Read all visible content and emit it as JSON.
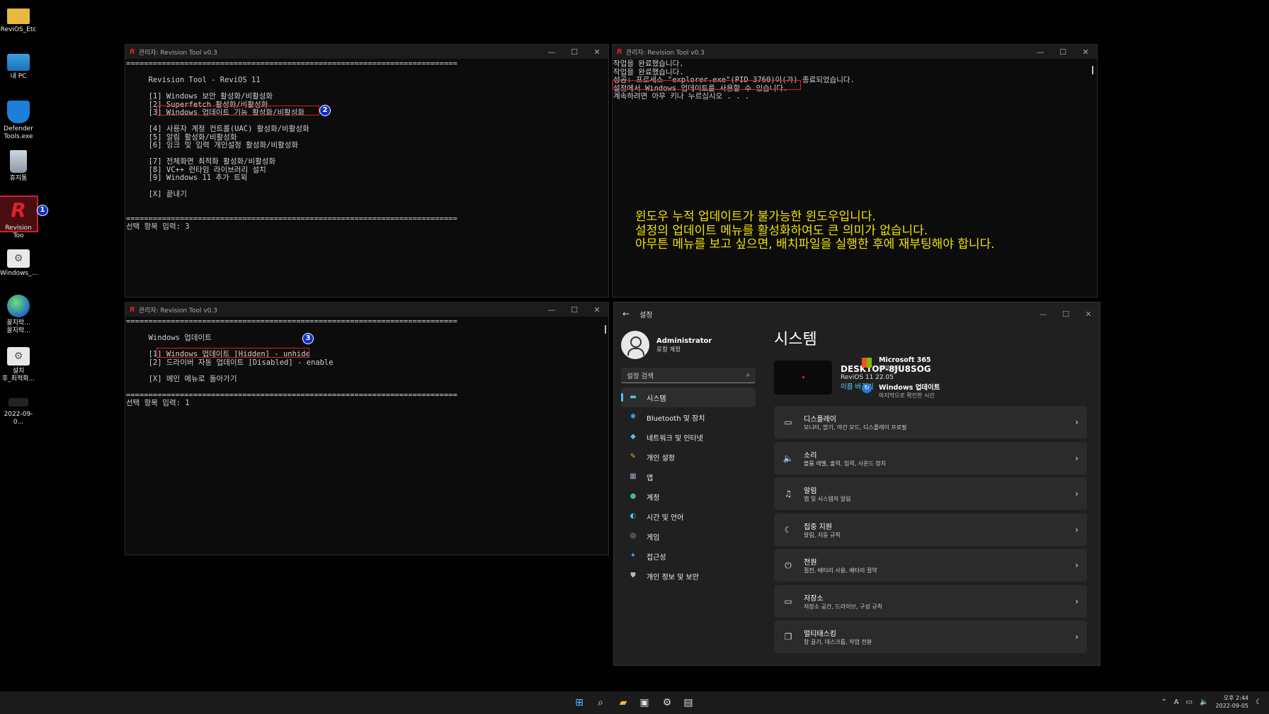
{
  "desktop": {
    "icons": [
      {
        "label": "ReviOS_Etc",
        "icon": "folder-icon"
      },
      {
        "label": "내 PC",
        "icon": "monitor-icon"
      },
      {
        "label": "Defender\nTools.exe",
        "icon": "shield-icon"
      },
      {
        "label": "휴지통",
        "icon": "recycle-bin-icon"
      },
      {
        "label": "Revision Too",
        "icon": "revision-tool-icon"
      },
      {
        "label": "Windows_...",
        "icon": "settings-file-icon"
      },
      {
        "label": "꿀지락...\n꿀지락...",
        "icon": "globe-icon"
      },
      {
        "label": "설치\n후_최적화...",
        "icon": "settings-file-icon"
      },
      {
        "label": "2022-09-0...",
        "icon": "screenshot-icon"
      }
    ],
    "badge1": "1"
  },
  "win_main": {
    "title": "관리자:  Revision Tool v0.3",
    "lines": [
      "==========================================================================",
      "",
      "     Revision Tool - ReviOS 11",
      "",
      "     [1] Windows 보안 활성화/비활성화",
      "     [2] Superfetch 활성화/비활성화",
      "     [3] Windows 업데이트 기능 활성화/비활성화",
      "",
      "     [4] 사용자 계정 컨트롤(UAC) 활성화/비활성화",
      "     [5] 알림 활성화/비활성화",
      "     [6] 잉크 및 입력 개인설정 활성화/비활성화",
      "",
      "     [7] 전체화면 최적화 활성화/비활성화",
      "     [8] VC++ 런타임 라이브러리 설치",
      "     [9] Windows 11 추가 트윅",
      "",
      "     [X] 끝내기",
      "",
      "",
      "==========================================================================",
      "선택 항목 입력: 3"
    ],
    "badge": "2"
  },
  "win_log": {
    "title": "관리자:  Revision Tool v0.3",
    "lines": [
      "작업을 완료했습니다.",
      "작업을 완료했습니다.",
      "성공: 프로세스 \"explorer.exe\"(PID 3760)이(가) 종료되었습니다.",
      "설정에서 Windows 업데이트를 사용할 수 있습니다.",
      "계속하려면 아무 키나 누르십시오 . . ."
    ],
    "note": [
      "윈도우 누적 업데이트가 불가능한 윈도우입니다.",
      "설정의 업데이트 메뉴를 활성화하여도 큰 의미가 없습니다.",
      "아무튼 메뉴를 보고 싶으면, 배치파일을 실행한 후에 재부팅해야 합니다."
    ]
  },
  "win_update": {
    "title": "관리자:  Revision Tool v0.3",
    "lines": [
      "==========================================================================",
      "",
      "     Windows 업데이트",
      "",
      "     [1] Windows 업데이트 [Hidden] - unhide",
      "     [2] 드라이버 자동 업데이트 [Disabled] - enable",
      "",
      "     [X] 메인 메뉴로 돌아가기",
      "",
      "==========================================================================",
      "선택 항목 입력: 1"
    ],
    "badge": "3"
  },
  "settings": {
    "title": "설정",
    "profile_name": "Administrator",
    "profile_sub": "로컬 계정",
    "search_placeholder": "설정 검색",
    "nav": [
      {
        "label": "시스템",
        "icon": "system-icon",
        "color": "#4cc2ff",
        "glyph": "▬"
      },
      {
        "label": "Bluetooth 및 장치",
        "icon": "bluetooth-icon",
        "color": "#4c9bff",
        "glyph": "✱"
      },
      {
        "label": "네트워크 및 인터넷",
        "icon": "network-icon",
        "color": "#4cc2ff",
        "glyph": "◆"
      },
      {
        "label": "개인 설정",
        "icon": "brush-icon",
        "color": "#e8a040",
        "glyph": "✎"
      },
      {
        "label": "앱",
        "icon": "apps-icon",
        "color": "#9aa5c0",
        "glyph": "▦"
      },
      {
        "label": "계정",
        "icon": "account-icon",
        "color": "#3fc37a",
        "glyph": "●"
      },
      {
        "label": "시간 및 언어",
        "icon": "globe-clock-icon",
        "color": "#4cc2ff",
        "glyph": "◐"
      },
      {
        "label": "게임",
        "icon": "gamepad-icon",
        "color": "#b8b8b8",
        "glyph": "◎"
      },
      {
        "label": "접근성",
        "icon": "accessibility-icon",
        "color": "#4c9bff",
        "glyph": "✦"
      },
      {
        "label": "개인 정보 및 보안",
        "icon": "shield-icon",
        "color": "#b8b8b8",
        "glyph": "⛊"
      }
    ],
    "page_title": "시스템",
    "device_name": "DESKTOP-8JU8SOG",
    "device_os": "ReviOS 11 22.05",
    "rename_link": "이름 바꾸기",
    "ms365_title": "Microsoft 365",
    "ms365_sub": "혜택 보기",
    "wu_title": "Windows 업데이트",
    "wu_sub": "마지막으로 확인한 시간",
    "cards": [
      {
        "title": "디스플레이",
        "sub": "모니터, 밝기, 야간 모드, 디스플레이 프로필",
        "icon": "display-icon",
        "glyph": "▭"
      },
      {
        "title": "소리",
        "sub": "볼륨 레벨, 출력, 입력, 사운드 장치",
        "icon": "speaker-icon",
        "glyph": "🔈"
      },
      {
        "title": "알림",
        "sub": "앱 및 시스템의 알림",
        "icon": "bell-icon",
        "glyph": "♫"
      },
      {
        "title": "집중 지원",
        "sub": "알림, 자동 규칙",
        "icon": "moon-icon",
        "glyph": "☾"
      },
      {
        "title": "전원",
        "sub": "절전, 배터리 사용, 배터리 절약",
        "icon": "power-icon",
        "glyph": "⏻"
      },
      {
        "title": "저장소",
        "sub": "저장소 공간, 드라이브, 구성 규칙",
        "icon": "storage-icon",
        "glyph": "▭"
      },
      {
        "title": "멀티태스킹",
        "sub": "창 끌기, 데스크톱, 작업 전환",
        "icon": "multitask-icon",
        "glyph": "❐"
      }
    ]
  },
  "taskbar": {
    "time": "오후 2:44",
    "date": "2022-09-05",
    "lang": "A"
  },
  "colors": {
    "accent": "#4cc2ff",
    "highlight_box": "#e02020",
    "note_text": "#f2e200",
    "badge": "#1030c8"
  }
}
